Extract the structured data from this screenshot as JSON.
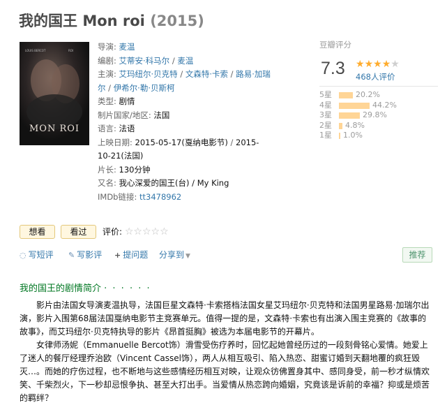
{
  "title": {
    "cn": "我的国王",
    "en": "Mon roi",
    "year": "(2015)"
  },
  "poster": {
    "tagline_top_left": "LOUIS BERCOT",
    "tagline_top_right": "ROI",
    "text": "MON ROI",
    "bg": "#1a1a1c"
  },
  "info": {
    "director_label": "导演:",
    "director": "麦温",
    "writer_label": "编剧:",
    "writers": [
      "艾蒂安·科马尔",
      "麦温"
    ],
    "cast_label": "主演:",
    "cast": [
      "艾玛纽尔·贝克特",
      "文森特·卡索",
      "路易·加瑞尔",
      "伊希尔·勒·贝斯柯"
    ],
    "genre_label": "类型:",
    "genre": "剧情",
    "country_label": "制片国家/地区:",
    "country": "法国",
    "language_label": "语言:",
    "language": "法语",
    "release_label": "上映日期:",
    "release_1": "2015-05-17(戛纳电影节)",
    "release_2": "2015-10-21(法国)",
    "runtime_label": "片长:",
    "runtime": "130分钟",
    "aka_label": "又名:",
    "aka": "我心深爱的国王(台) / My King",
    "imdb_label": "IMDb链接:",
    "imdb": "tt3478962"
  },
  "rating": {
    "title": "豆瓣评分",
    "score": "7.3",
    "stars_filled": 4,
    "stars_total": 5,
    "count": "468人评价",
    "distribution": [
      {
        "label": "5星",
        "pct": "20.2%",
        "value": 0.202
      },
      {
        "label": "4星",
        "pct": "44.2%",
        "value": 0.442
      },
      {
        "label": "3星",
        "pct": "29.8%",
        "value": 0.298
      },
      {
        "label": "2星",
        "pct": "4.8%",
        "value": 0.048
      },
      {
        "label": "1星",
        "pct": "1.0%",
        "value": 0.01
      }
    ],
    "star_color": "#ffac2d",
    "bar_color": "#ffd596"
  },
  "actions": {
    "wish": "想看",
    "seen": "看过",
    "rate_label": "评价:",
    "rate_stars": "☆☆☆☆☆",
    "write_short": "写短评",
    "write_review": "写影评",
    "ask": "提问题",
    "share": "分享到",
    "recommend": "推荐"
  },
  "intro": {
    "title": "我的国王的剧情简介",
    "title_dots": "· · · · · ·",
    "p1": "影片由法国女导演麦温执导，法国巨星文森特·卡索搭档法国女星艾玛纽尔·贝克特和法国男星路易·加瑞尔出演，影片入围第68届法国戛纳电影节主竞赛单元。值得一提的是，文森特·卡索也有出演入围主竞赛的《故事的故事》，而艾玛纽尔·贝克特执导的影片《昂首挺胸》被选为本届电影节的开幕片。",
    "p2": "女律师汤妮（Emmanuelle Bercot饰）滑雪受伤疗养时，回忆起她曾经历过的一段刻骨铭心爱情。她爱上了迷人的餐厅经理乔治欧（Vincent Cassel饰），两人从相互吸引、陷入热恋、甜蜜订婚到天翻地覆的疯狂毁灭…。而她的疗伤过程，也不断地与这些感情经历相互对映，让观众彷佛置身其中、感同身受，前一秒才纵情欢笑、千柴烈火，下一秒却忌恨争执、甚至大打出手。当爱情从热恋跨向婚姻，究竟该是诉前的幸福？抑或是烦苦的羁绊？"
  },
  "colors": {
    "link": "#3377aa",
    "green": "#007722"
  }
}
